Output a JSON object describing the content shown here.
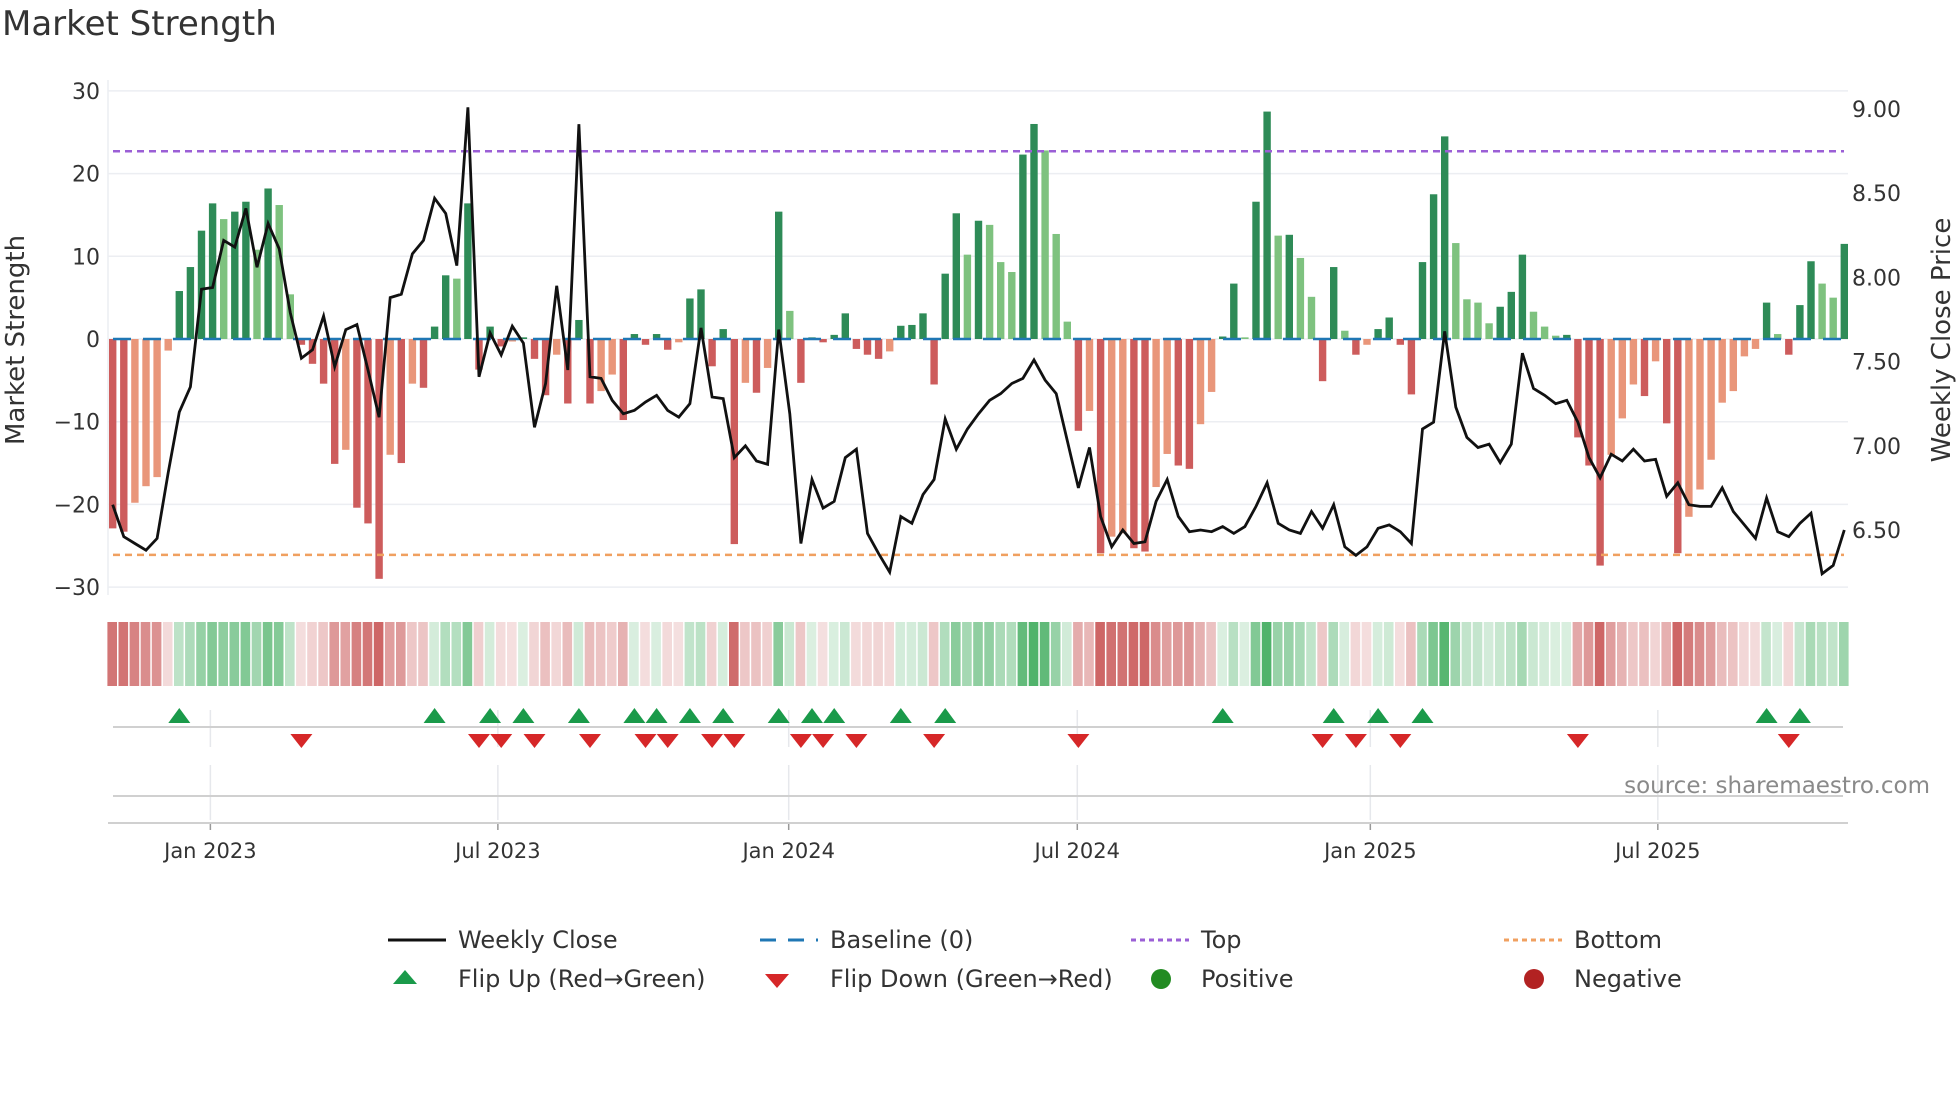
{
  "title": "Market Strength",
  "source": "source: sharemaestro.com",
  "colors": {
    "strong_green": "#2e8b57",
    "weak_green": "#7ec27f",
    "strong_red": "#cd5c5c",
    "weak_red": "#e9967a",
    "close_line": "#111111",
    "baseline": "#1f77b4",
    "top": "#9b5fd6",
    "bottom": "#f0a060",
    "flip_up": "#1a9a4a",
    "flip_down": "#d62728",
    "positive": "#228b22",
    "negative": "#b22222"
  },
  "legend": {
    "weekly_close": "Weekly Close",
    "baseline": "Baseline (0)",
    "top": "Top",
    "bottom": "Bottom",
    "flip_up": "Flip Up (Red→Green)",
    "flip_down": "Flip Down (Green→Red)",
    "positive": "Positive",
    "negative": "Negative"
  },
  "chart_data": {
    "type": "bar+line",
    "title": "Market Strength",
    "ylabel": "Market Strength",
    "y2label": "Weekly Close Price",
    "ylim": [
      -31.3,
      31.3
    ],
    "y2lim": [
      6.16,
      9.11
    ],
    "yticks": [
      30,
      20,
      10,
      0,
      -10,
      -20,
      -30
    ],
    "ytick_labels": [
      "30",
      "20",
      "10",
      "0",
      "−10",
      "−20",
      "−30"
    ],
    "y2ticks": [
      9.0,
      8.5,
      8.0,
      7.5,
      7.0,
      6.5
    ],
    "y2tick_labels": [
      "9.00",
      "8.50",
      "8.00",
      "7.50",
      "7.00",
      "6.50"
    ],
    "xticks_week_index": [
      8.8,
      34.7,
      60.9,
      86.9,
      113.3,
      139.2
    ],
    "xtick_labels": [
      "Jan 2023",
      "Jul 2023",
      "Jan 2024",
      "Jul 2024",
      "Jan 2025",
      "Jul 2025"
    ],
    "top_level": 22.7,
    "bottom_level": -26.1,
    "baseline": 0,
    "strength": [
      -22.9,
      -23.3,
      -19.8,
      -17.8,
      -16.7,
      -1.4,
      5.8,
      8.7,
      13.1,
      16.4,
      14.5,
      15.4,
      16.6,
      10.8,
      18.2,
      16.2,
      5.4,
      -0.7,
      -3,
      -5.4,
      -15.1,
      -13.4,
      -20.4,
      -22.3,
      -29,
      -14,
      -15,
      -5.4,
      -5.9,
      1.5,
      7.7,
      7.3,
      16.4,
      -3.7,
      1.5,
      -0.9,
      -0.3,
      0.2,
      -2.4,
      -6.8,
      -1.9,
      -7.8,
      2.3,
      -7.8,
      -6.3,
      -4.3,
      -9.8,
      0.6,
      -0.7,
      0.6,
      -1.3,
      -0.4,
      4.9,
      6.0,
      -3.3,
      1.2,
      -24.8,
      -5.3,
      -6.5,
      -3.5,
      15.4,
      3.4,
      -5.3,
      0.2,
      -0.4,
      0.5,
      3.1,
      -1.2,
      -1.9,
      -2.4,
      -1.5,
      1.6,
      1.7,
      3.1,
      -5.5,
      7.9,
      15.2,
      10.2,
      14.3,
      13.8,
      9.3,
      8.1,
      22.3,
      26,
      22.8,
      12.7,
      2.1,
      -11.1,
      -8.7,
      -25.9,
      -23.9,
      -23.5,
      -25.3,
      -25.7,
      -17.9,
      -13.9,
      -15.3,
      -15.7,
      -10.3,
      -6.4,
      0.3,
      6.7,
      0.2,
      16.6,
      27.5,
      12.5,
      12.6,
      9.8,
      5.1,
      -5.1,
      8.7,
      1.0,
      -1.9,
      -0.7,
      1.2,
      2.6,
      -0.7,
      -6.7,
      9.3,
      17.5,
      24.5,
      11.6,
      4.8,
      4.4,
      1.9,
      3.9,
      5.7,
      10.2,
      3.3,
      1.5,
      0.4,
      0.5,
      -11.9,
      -15.3,
      -27.4,
      -14,
      -9.6,
      -5.5,
      -6.9,
      -2.7,
      -10.2,
      -25.9,
      -21.5,
      -18.2,
      -14.6,
      -7.7,
      -6.3,
      -2.1,
      -1.2,
      4.4,
      0.6,
      -1.9,
      4.1,
      9.4,
      6.7,
      5.0,
      11.5
    ],
    "close": [
      6.65,
      6.46,
      6.42,
      6.38,
      6.45,
      6.84,
      7.2,
      7.35,
      7.93,
      7.94,
      8.22,
      8.18,
      8.41,
      8.06,
      8.32,
      8.17,
      7.79,
      7.52,
      7.57,
      7.77,
      7.47,
      7.69,
      7.72,
      7.45,
      7.17,
      7.88,
      7.9,
      8.14,
      8.22,
      8.47,
      8.38,
      8.07,
      9.01,
      7.41,
      7.67,
      7.54,
      7.71,
      7.61,
      7.11,
      7.37,
      7.95,
      7.45,
      8.91,
      7.41,
      7.4,
      7.27,
      7.19,
      7.21,
      7.26,
      7.3,
      7.21,
      7.17,
      7.25,
      7.7,
      7.29,
      7.28,
      6.93,
      7.0,
      6.91,
      6.89,
      7.69,
      7.19,
      6.42,
      6.8,
      6.63,
      6.67,
      6.93,
      6.98,
      6.48,
      6.36,
      6.25,
      6.58,
      6.54,
      6.71,
      6.8,
      7.16,
      6.98,
      7.1,
      7.19,
      7.27,
      7.31,
      7.37,
      7.4,
      7.51,
      7.39,
      7.31,
      7.03,
      6.75,
      6.99,
      6.58,
      6.4,
      6.5,
      6.42,
      6.43,
      6.67,
      6.8,
      6.58,
      6.49,
      6.5,
      6.49,
      6.52,
      6.48,
      6.52,
      6.64,
      6.78,
      6.54,
      6.5,
      6.48,
      6.61,
      6.51,
      6.65,
      6.4,
      6.35,
      6.4,
      6.51,
      6.53,
      6.49,
      6.42,
      7.1,
      7.14,
      7.68,
      7.23,
      7.05,
      6.99,
      7.01,
      6.9,
      7.01,
      7.55,
      7.34,
      7.3,
      7.25,
      7.27,
      7.14,
      6.93,
      6.81,
      6.95,
      6.91,
      6.98,
      6.91,
      6.92,
      6.7,
      6.78,
      6.65,
      6.64,
      6.64,
      6.75,
      6.61,
      6.53,
      6.45,
      6.69,
      6.49,
      6.46,
      6.54,
      6.6,
      6.24,
      6.29,
      6.5
    ],
    "flip_up_weeks": [
      7,
      30,
      35,
      38,
      43,
      48,
      50,
      53,
      56,
      61,
      64,
      66,
      72,
      76,
      101,
      111,
      115,
      119,
      150,
      153
    ],
    "flip_down_weeks": [
      18,
      34,
      36,
      39,
      44,
      49,
      51,
      55,
      57,
      63,
      65,
      68,
      75,
      88,
      110,
      113,
      117,
      133,
      152
    ],
    "legend_position": "bottom"
  }
}
